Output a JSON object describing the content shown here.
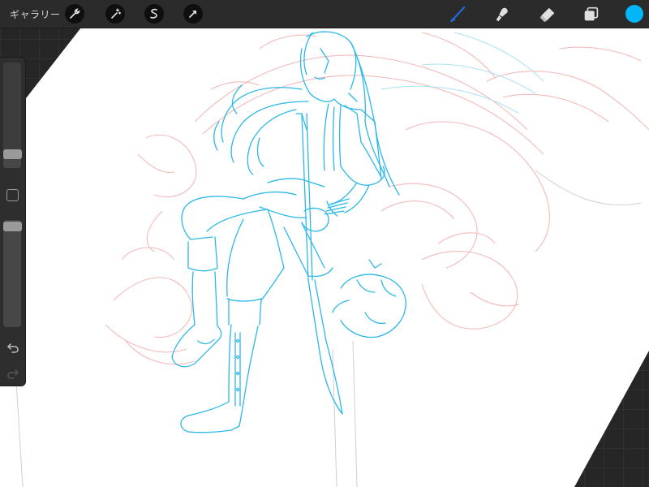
{
  "toolbar": {
    "gallery_label": "ギャラリー",
    "left_tools": [
      "wrench-icon",
      "magic-wand-icon",
      "selection-icon",
      "transform-arrow-icon"
    ],
    "right_tools": [
      "brush-icon",
      "smudge-icon",
      "eraser-icon",
      "layers-icon"
    ],
    "active_tool": "brush-icon",
    "active_tool_color": "#1e6fe6",
    "current_color": "#00b6f7"
  },
  "sidebar": {
    "brush_size_level": 0.15,
    "opacity_level": 1.0,
    "modify_button_icon": "square-icon",
    "undo_icon": "undo-icon",
    "redo_icon": "redo-icon"
  },
  "canvas": {
    "background": "#ffffff",
    "sketch_colors": [
      "#2bb8e6",
      "#f2b5b5",
      "#c9c9c9",
      "#a8e3ee"
    ]
  }
}
